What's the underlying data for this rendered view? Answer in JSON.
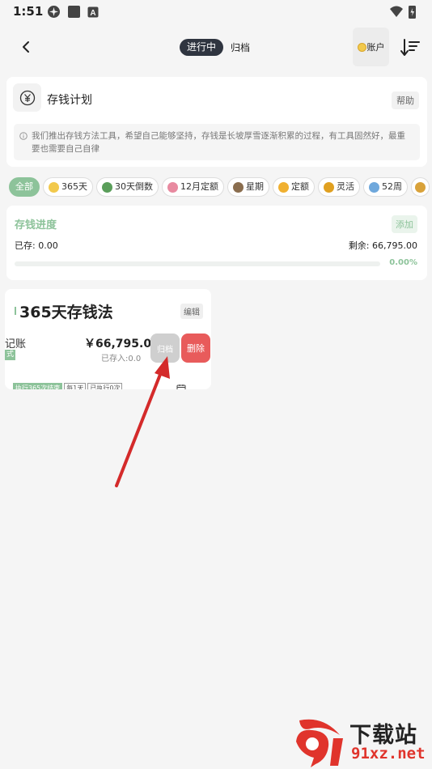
{
  "status_bar": {
    "time": "1:51"
  },
  "header": {
    "tab_active": "进行中",
    "tab_inactive": "归档",
    "account_label": "账户"
  },
  "intro": {
    "title": "存钱计划",
    "help_label": "帮助",
    "tip": "我们推出存钱方法工具，希望自己能够坚持，存钱是长坡厚雪逐渐积累的过程，有工具固然好，最重要也需要自己自律"
  },
  "chips": [
    {
      "label": "全部",
      "active": true
    },
    {
      "label": "365天",
      "emoji_color": "#f2c94c"
    },
    {
      "label": "30天倒数",
      "emoji_color": "#5a9e5a"
    },
    {
      "label": "12月定额",
      "emoji_color": "#e88aa0"
    },
    {
      "label": "星期",
      "emoji_color": "#8a6d4e"
    },
    {
      "label": "定额",
      "emoji_color": "#f0b030"
    },
    {
      "label": "灵活",
      "emoji_color": "#e0a020"
    },
    {
      "label": "52周",
      "emoji_color": "#6fa8dc"
    }
  ],
  "progress": {
    "title": "存钱进度",
    "add_label": "添加",
    "saved": "已存: 0.00",
    "remaining": "剩余: 66,795.00",
    "percent_label": "0.00%",
    "percent_value": 0
  },
  "plan_card": {
    "name": "365天存钱法",
    "edit_label": "编辑",
    "bookkeep_label": "记账",
    "mode_tag": "式",
    "amount": "￥66,795.00",
    "saved_in": "已存入:0.0",
    "archive_label": "归档",
    "delete_label": "删除",
    "tags": [
      "执行365次结束",
      "每1天",
      "已执行0次"
    ]
  },
  "watermark": {
    "line1": "下载站",
    "line2": "91xz.net"
  },
  "colors": {
    "accent_green": "#8dc39a",
    "delete_red": "#e85b5b",
    "annotation_red": "#d42a2a"
  }
}
